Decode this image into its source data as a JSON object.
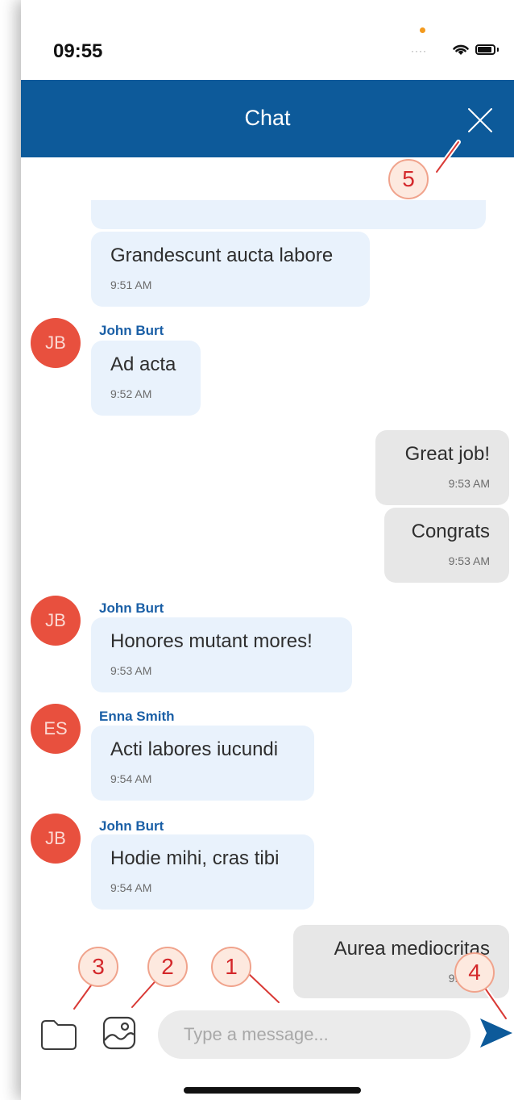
{
  "status_bar": {
    "time": "09:55"
  },
  "header": {
    "title": "Chat"
  },
  "messages": [
    {
      "direction": "in",
      "text": "Grandescunt aucta labore",
      "time": "9:51 AM"
    },
    {
      "direction": "in",
      "sender": "John Burt",
      "initials": "JB",
      "text": "Ad acta",
      "time": "9:52 AM"
    },
    {
      "direction": "out",
      "text": "Great job!",
      "time": "9:53 AM"
    },
    {
      "direction": "out",
      "text": "Congrats",
      "time": "9:53 AM"
    },
    {
      "direction": "in",
      "sender": "John Burt",
      "initials": "JB",
      "text": "Honores mutant mores!",
      "time": "9:53 AM"
    },
    {
      "direction": "in",
      "sender": "Enna Smith",
      "initials": "ES",
      "text": "Acti labores iucundi",
      "time": "9:54 AM"
    },
    {
      "direction": "in",
      "sender": "John Burt",
      "initials": "JB",
      "text": "Hodie mihi, cras tibi",
      "time": "9:54 AM"
    },
    {
      "direction": "out",
      "text": "Aurea mediocritas",
      "time": "9:55 AM"
    }
  ],
  "composer": {
    "placeholder": "Type a message...",
    "value": ""
  },
  "callouts": [
    "1",
    "2",
    "3",
    "4",
    "5"
  ],
  "colors": {
    "header": "#0d5a9a",
    "incoming_bubble": "#e9f2fc",
    "outgoing_bubble": "#e7e7e7",
    "avatar": "#e8503e",
    "sender_name": "#1a5fa6",
    "send_arrow": "#0d5a9a"
  }
}
